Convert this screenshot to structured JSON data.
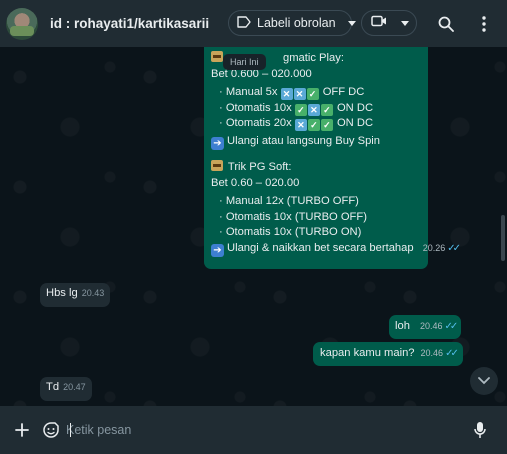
{
  "header": {
    "title": "id : rohayati1/kartikasarii",
    "label_button": "Labeli obrolan"
  },
  "chat": {
    "date_chip": "Hari Ini",
    "big_message": {
      "line1": "Bet 0.600 – 020.000",
      "header_partial": "gmatic Play:",
      "pp_rows": [
        {
          "text": "Manual 5x",
          "icons": [
            "x",
            "x",
            "check"
          ],
          "suffix": "OFF DC"
        },
        {
          "text": "Otomatis 10x",
          "icons": [
            "check",
            "x",
            "check"
          ],
          "suffix": "ON DC"
        },
        {
          "text": "Otomatis 20x",
          "icons": [
            "x",
            "check",
            "check"
          ],
          "suffix": "ON DC"
        }
      ],
      "pp_tip": "Ulangi atau langsung Buy Spin",
      "pg_title": "Trik PG Soft:",
      "pg_bet": "Bet 0.60 – 020.00",
      "pg_rows": [
        "Manual 12x (TURBO OFF)",
        "Otomatis 10x (TURBO OFF)",
        "Otomatis 10x (TURBO ON)"
      ],
      "pg_tip": "Ulangi & naikkan bet secara bertahap",
      "time": "20.26"
    },
    "msg_hbs": {
      "text": "Hbs lg",
      "time": "20.43"
    },
    "msg_loh": {
      "text": "loh",
      "time": "20.46"
    },
    "msg_kapan": {
      "text": "kapan kamu main?",
      "time": "20.46"
    },
    "msg_td": {
      "text": "Td",
      "time": "20.47"
    }
  },
  "footer": {
    "placeholder": "Ketik pesan"
  }
}
